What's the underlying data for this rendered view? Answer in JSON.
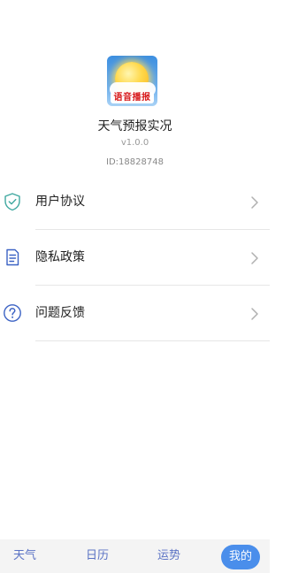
{
  "app": {
    "logo_badge": "语音播报",
    "name": "天气预报实况",
    "version": "v1.0.0",
    "id": "ID:18828748"
  },
  "menu": [
    {
      "label": "用户协议",
      "icon": "shield-check-icon"
    },
    {
      "label": "隐私政策",
      "icon": "document-icon"
    },
    {
      "label": "问题反馈",
      "icon": "question-icon"
    }
  ],
  "tabs": [
    {
      "label": "天气",
      "active": false
    },
    {
      "label": "日历",
      "active": false
    },
    {
      "label": "运势",
      "active": false
    },
    {
      "label": "我的",
      "active": true
    }
  ],
  "colors": {
    "accent": "#4a8eeb",
    "tab_text": "#5b73c4",
    "icon_teal": "#3fa8a0",
    "icon_blue": "#3b62c4",
    "chevron": "#b0b0b0"
  }
}
